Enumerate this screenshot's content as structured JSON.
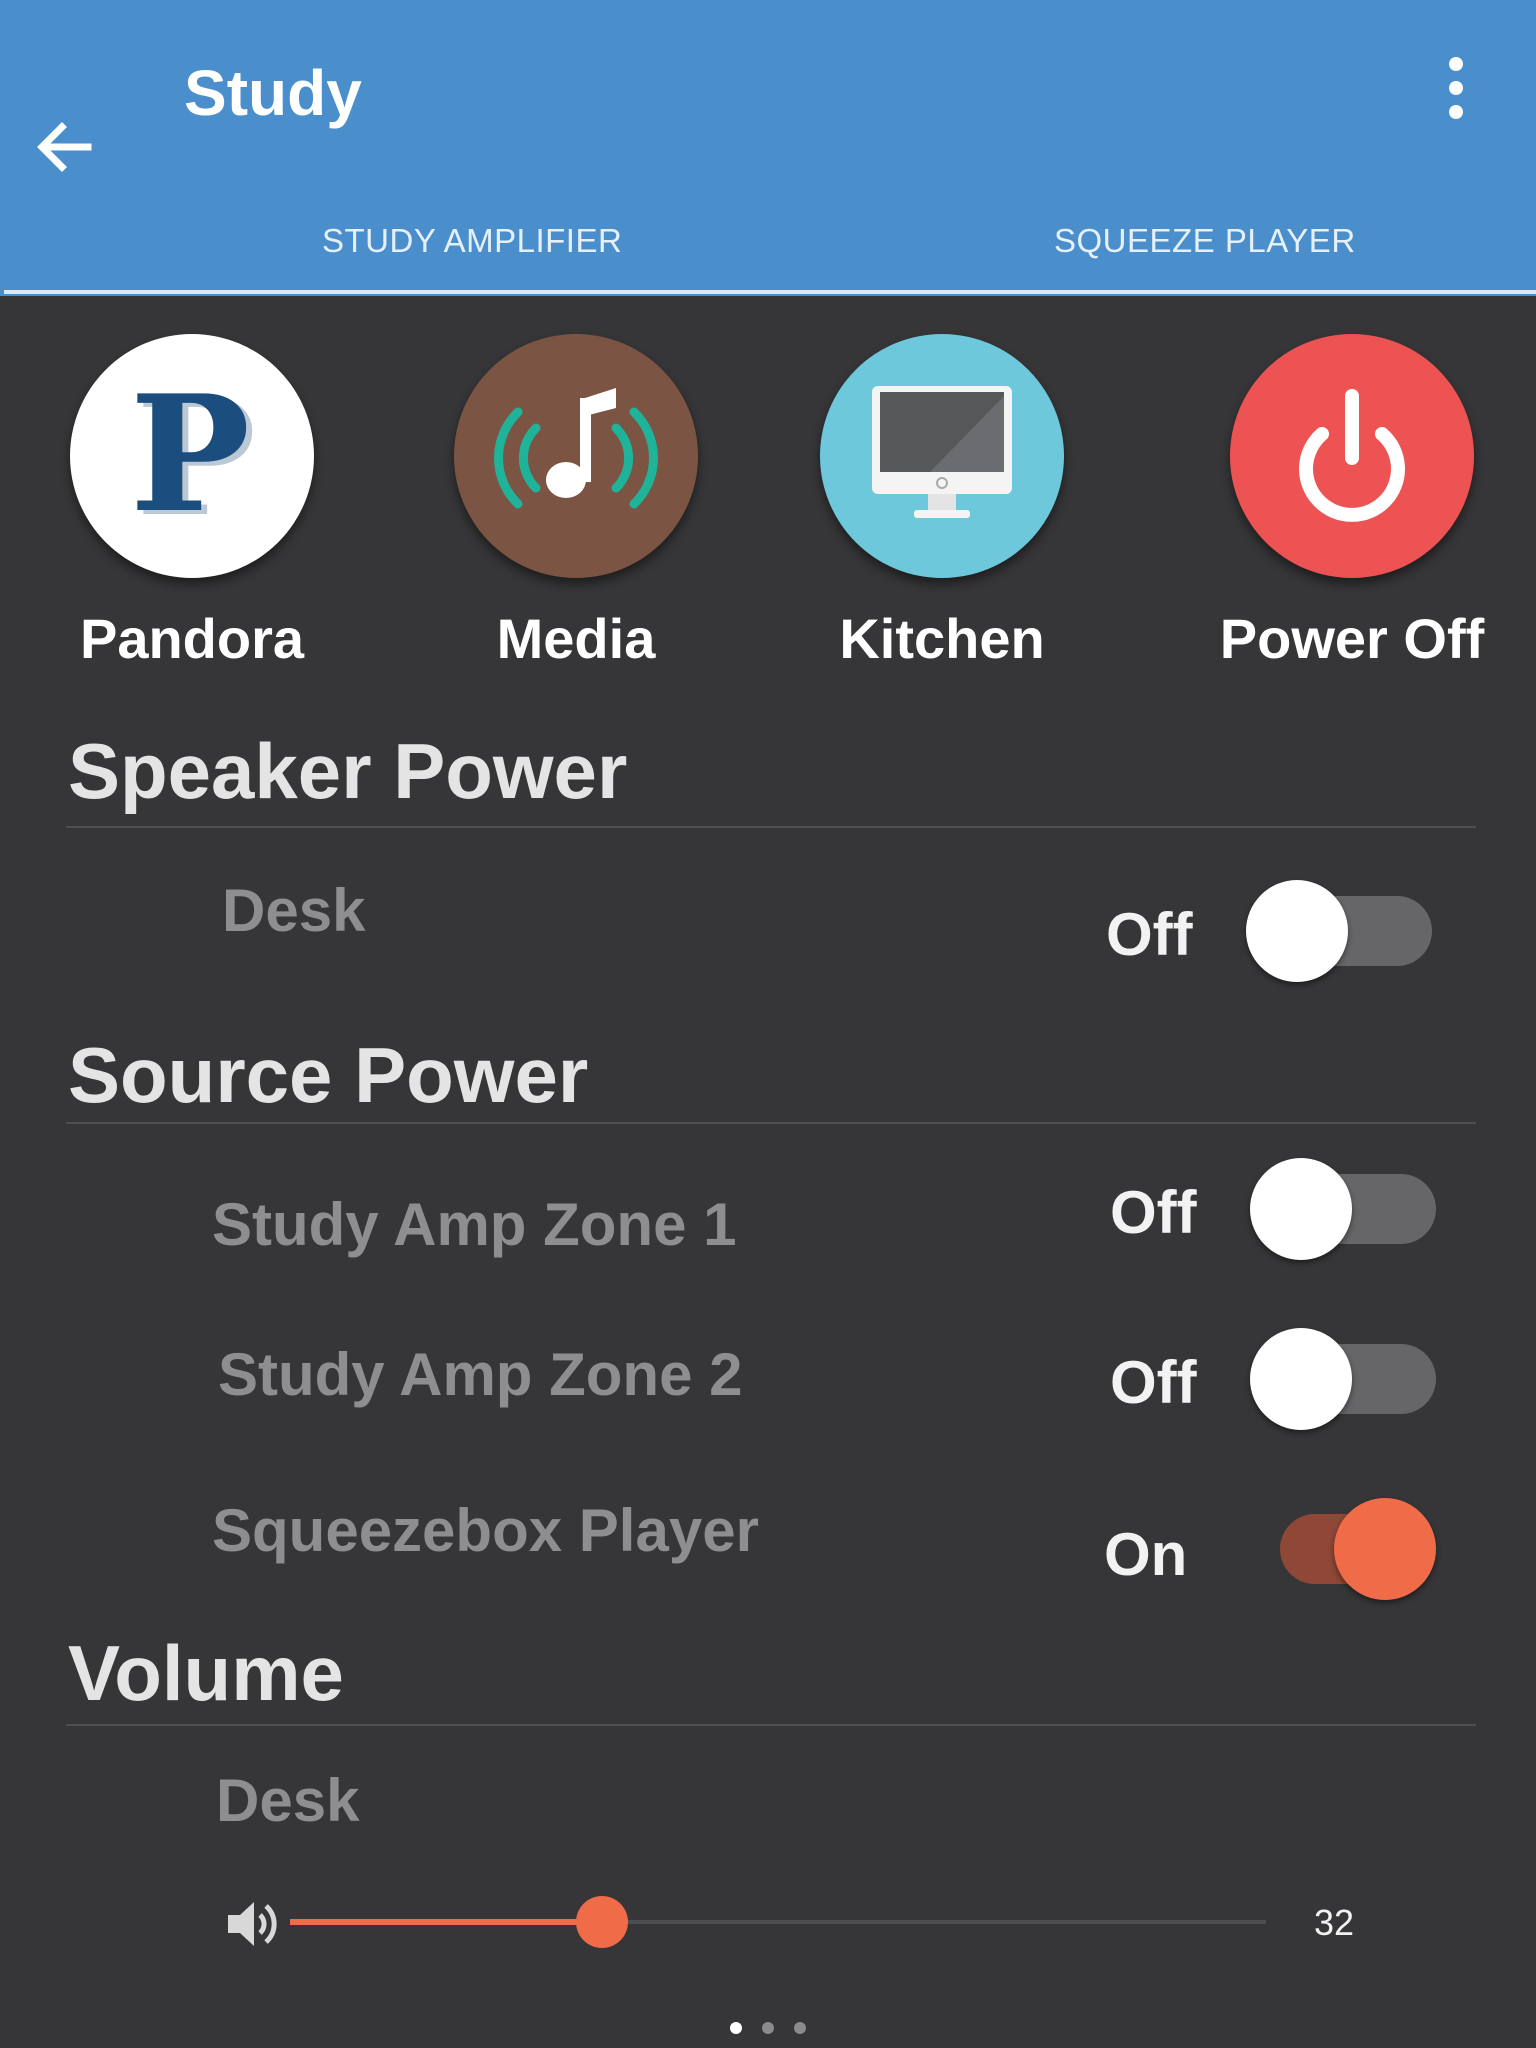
{
  "header": {
    "title": "Study",
    "back_icon": "arrow-left-icon",
    "menu_icon": "more-vert-icon"
  },
  "tabs": [
    {
      "label": "STUDY AMPLIFIER",
      "active": true
    },
    {
      "label": "SQUEEZE PLAYER",
      "active": false
    }
  ],
  "shortcuts": [
    {
      "label": "Pandora",
      "icon": "pandora-icon",
      "color": "#ffffff"
    },
    {
      "label": "Media",
      "icon": "music-broadcast-icon",
      "color": "#7b5444"
    },
    {
      "label": "Kitchen",
      "icon": "monitor-icon",
      "color": "#6ec8dc"
    },
    {
      "label": "Power Off",
      "icon": "power-icon",
      "color": "#ee5354"
    }
  ],
  "speaker_power": {
    "title": "Speaker Power",
    "rows": [
      {
        "label": "Desk",
        "state": "Off",
        "on": false
      }
    ]
  },
  "source_power": {
    "title": "Source Power",
    "rows": [
      {
        "label": "Study Amp Zone 1",
        "state": "Off",
        "on": false
      },
      {
        "label": "Study Amp Zone 2",
        "state": "Off",
        "on": false
      },
      {
        "label": "Squeezebox Player",
        "state": "On",
        "on": true
      }
    ]
  },
  "volume": {
    "title": "Volume",
    "label": "Desk",
    "value": "32",
    "level": 0.32,
    "icon": "speaker-volume-icon"
  },
  "pager": {
    "pages": 3,
    "active": 0
  },
  "colors": {
    "appbar": "#4a8fcc",
    "background": "#363638",
    "accent": "#f06c48"
  }
}
